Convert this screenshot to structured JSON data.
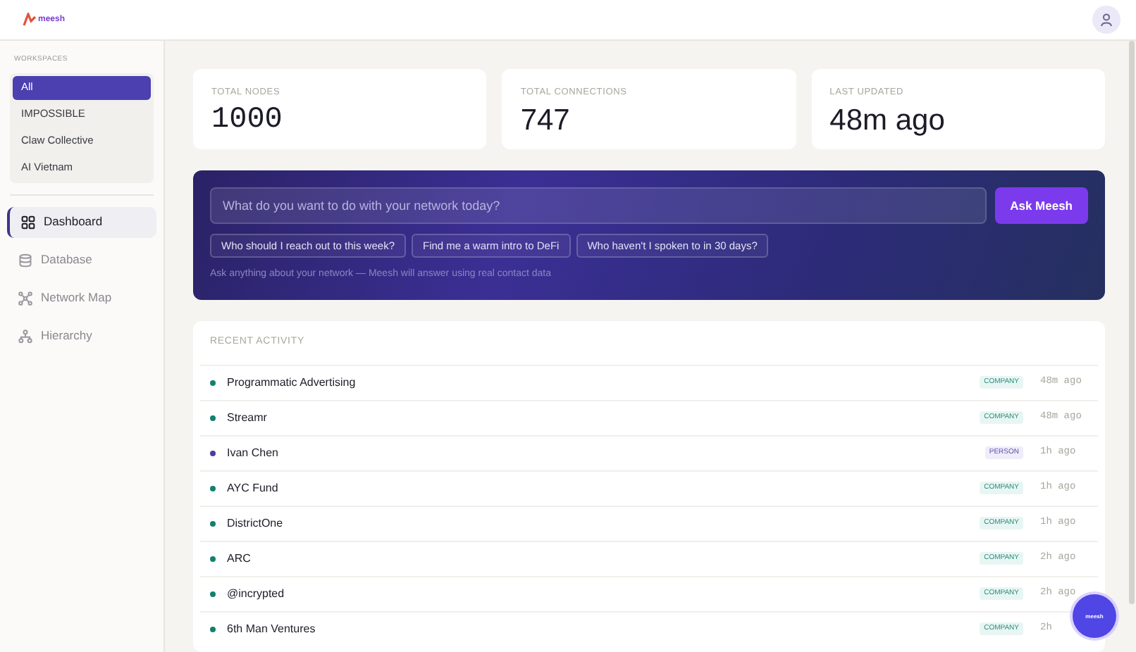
{
  "logo": "meesh",
  "workspaces": {
    "heading": "WORKSPACES",
    "items": [
      {
        "label": "All",
        "selected": true
      },
      {
        "label": "IMPOSSIBLE",
        "selected": false
      },
      {
        "label": "Claw Collective",
        "selected": false
      },
      {
        "label": "AI Vietnam",
        "selected": false
      }
    ]
  },
  "nav": [
    {
      "label": "Dashboard",
      "selected": true
    },
    {
      "label": "Database",
      "selected": false
    },
    {
      "label": "Network Map",
      "selected": false
    },
    {
      "label": "Hierarchy",
      "selected": false
    }
  ],
  "stats": [
    {
      "label": "TOTAL NODES",
      "value": "1000"
    },
    {
      "label": "TOTAL CONNECTIONS",
      "value": "747"
    },
    {
      "label": "LAST UPDATED",
      "value": "48m ago"
    }
  ],
  "ask": {
    "placeholder": "What do you want to do with your network today?",
    "button": "Ask Meesh",
    "suggestions": [
      "Who should I reach out to this week?",
      "Find me a warm intro to DeFi",
      "Who haven't I spoken to in 30 days?"
    ],
    "hint": "Ask anything about your network — Meesh will answer using real contact data"
  },
  "activity": {
    "heading": "RECENT ACTIVITY",
    "rows": [
      {
        "name": "Programmatic Advertising",
        "tag": "COMPANY",
        "kind": "company",
        "time": "48m ago"
      },
      {
        "name": "Streamr",
        "tag": "COMPANY",
        "kind": "company",
        "time": "48m ago"
      },
      {
        "name": "Ivan Chen",
        "tag": "PERSON",
        "kind": "person",
        "time": "1h ago"
      },
      {
        "name": "AYC Fund",
        "tag": "COMPANY",
        "kind": "company",
        "time": "1h ago"
      },
      {
        "name": "DistrictOne",
        "tag": "COMPANY",
        "kind": "company",
        "time": "1h ago"
      },
      {
        "name": "ARC",
        "tag": "COMPANY",
        "kind": "company",
        "time": "2h ago"
      },
      {
        "name": "@incrypted",
        "tag": "COMPANY",
        "kind": "company",
        "time": "2h ago"
      },
      {
        "name": "6th Man Ventures",
        "tag": "COMPANY",
        "kind": "company",
        "time": "2h"
      }
    ]
  },
  "chat_button": "meesh"
}
